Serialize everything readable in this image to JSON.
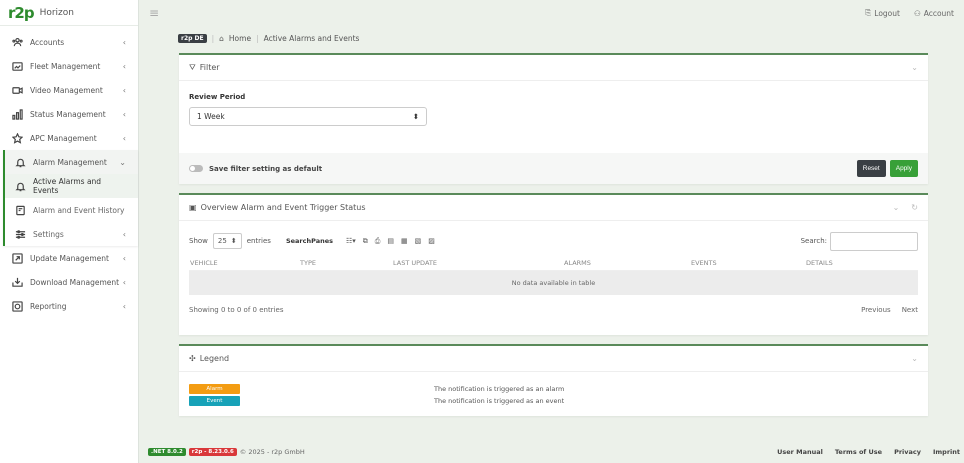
{
  "brand": {
    "logo": "r2p",
    "name": "Horizon"
  },
  "topbar": {
    "logout": "Logout",
    "account": "Account"
  },
  "sidebar": {
    "items": [
      {
        "label": "Accounts",
        "icon": "accounts-icon"
      },
      {
        "label": "Fleet Management",
        "icon": "fleet-icon"
      },
      {
        "label": "Video Management",
        "icon": "video-icon"
      },
      {
        "label": "Status Management",
        "icon": "status-icon"
      },
      {
        "label": "APC Management",
        "icon": "star-icon"
      }
    ],
    "group": {
      "label": "Alarm Management",
      "children": [
        {
          "label": "Active Alarms and Events",
          "active": true
        },
        {
          "label": "Alarm and Event History"
        },
        {
          "label": "Settings"
        }
      ]
    },
    "after": [
      {
        "label": "Update Management"
      },
      {
        "label": "Download Management"
      },
      {
        "label": "Reporting"
      }
    ]
  },
  "breadcrumb": {
    "env": "r2p DE",
    "home": "Home",
    "current": "Active Alarms and Events"
  },
  "filter": {
    "title": "Filter",
    "review_label": "Review Period",
    "review_value": "1 Week",
    "save_default": "Save filter setting as default",
    "reset": "Reset",
    "apply": "Apply"
  },
  "overview": {
    "title": "Overview Alarm and Event Trigger Status",
    "show": "Show",
    "length": "25",
    "entries": "entries",
    "searchpanes": "SearchPanes",
    "search_label": "Search:",
    "columns": [
      "VEHICLE",
      "TYPE",
      "LAST UPDATE",
      "ALARMS",
      "EVENTS",
      "DETAILS"
    ],
    "empty": "No data available in table",
    "info": "Showing 0 to 0 of 0 entries",
    "previous": "Previous",
    "next": "Next"
  },
  "legend": {
    "title": "Legend",
    "items": [
      {
        "tag": "Alarm",
        "text": "The notification is triggered as an alarm",
        "color": "#f39c12"
      },
      {
        "tag": "Event",
        "text": "The notification is triggered as an event",
        "color": "#17a2b8"
      }
    ]
  },
  "footer": {
    "net_tag": ".NET 8.0.2",
    "ver_tag": "r2p - 8.23.0.6",
    "copyright": "© 2025 - r2p GmbH",
    "links": [
      "User Manual",
      "Terms of Use",
      "Privacy",
      "Imprint"
    ]
  }
}
